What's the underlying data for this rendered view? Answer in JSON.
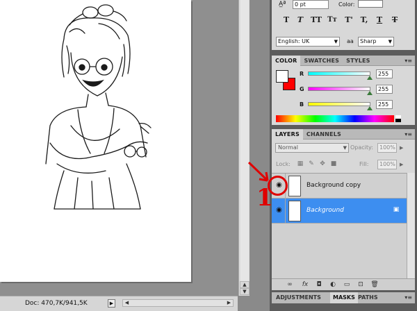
{
  "status": {
    "doc_info": "Doc: 470,7K/941,5K"
  },
  "character_panel": {
    "leading_value": "0 pt",
    "color_label": "Color:",
    "type_buttons": [
      "T",
      "T",
      "TT",
      "Tr",
      "T'",
      "T,",
      "T",
      "T"
    ],
    "language": "English: UK",
    "aa_label": "aa",
    "antialias": "Sharp"
  },
  "color_panel": {
    "tabs": [
      "COLOR",
      "SWATCHES",
      "STYLES"
    ],
    "foreground": "#ffffff",
    "background": "#ff0000",
    "sliders": [
      {
        "letter": "R",
        "value": "255"
      },
      {
        "letter": "G",
        "value": "255"
      },
      {
        "letter": "B",
        "value": "255"
      }
    ]
  },
  "layers_panel": {
    "tabs": [
      "LAYERS",
      "CHANNELS"
    ],
    "blend_mode": "Normal",
    "opacity_label": "Opacity:",
    "opacity_value": "100%",
    "lock_label": "Lock:",
    "fill_label": "Fill:",
    "fill_value": "100%",
    "layers": [
      {
        "name": "Background copy",
        "visible": true,
        "selected": false
      },
      {
        "name": "Background",
        "visible": true,
        "selected": true
      }
    ]
  },
  "bottom_tabs": [
    "ADJUSTMENTS",
    "MASKS",
    "PATHS"
  ],
  "annotation": {
    "number": "1",
    "color": "#e00000"
  }
}
